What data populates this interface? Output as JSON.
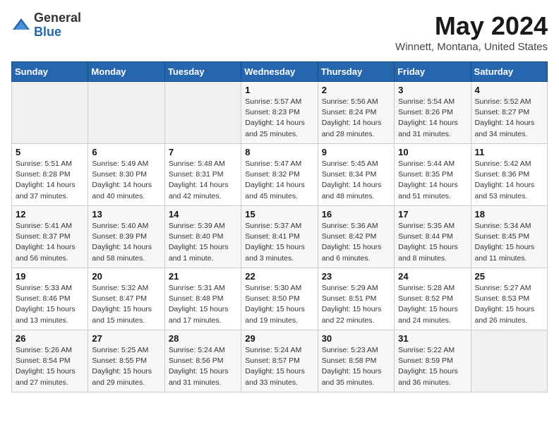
{
  "header": {
    "logo_general": "General",
    "logo_blue": "Blue",
    "main_title": "May 2024",
    "subtitle": "Winnett, Montana, United States"
  },
  "calendar": {
    "days_of_week": [
      "Sunday",
      "Monday",
      "Tuesday",
      "Wednesday",
      "Thursday",
      "Friday",
      "Saturday"
    ],
    "weeks": [
      [
        {
          "day": "",
          "info": ""
        },
        {
          "day": "",
          "info": ""
        },
        {
          "day": "",
          "info": ""
        },
        {
          "day": "1",
          "info": "Sunrise: 5:57 AM\nSunset: 8:23 PM\nDaylight: 14 hours\nand 25 minutes."
        },
        {
          "day": "2",
          "info": "Sunrise: 5:56 AM\nSunset: 8:24 PM\nDaylight: 14 hours\nand 28 minutes."
        },
        {
          "day": "3",
          "info": "Sunrise: 5:54 AM\nSunset: 8:26 PM\nDaylight: 14 hours\nand 31 minutes."
        },
        {
          "day": "4",
          "info": "Sunrise: 5:52 AM\nSunset: 8:27 PM\nDaylight: 14 hours\nand 34 minutes."
        }
      ],
      [
        {
          "day": "5",
          "info": "Sunrise: 5:51 AM\nSunset: 8:28 PM\nDaylight: 14 hours\nand 37 minutes."
        },
        {
          "day": "6",
          "info": "Sunrise: 5:49 AM\nSunset: 8:30 PM\nDaylight: 14 hours\nand 40 minutes."
        },
        {
          "day": "7",
          "info": "Sunrise: 5:48 AM\nSunset: 8:31 PM\nDaylight: 14 hours\nand 42 minutes."
        },
        {
          "day": "8",
          "info": "Sunrise: 5:47 AM\nSunset: 8:32 PM\nDaylight: 14 hours\nand 45 minutes."
        },
        {
          "day": "9",
          "info": "Sunrise: 5:45 AM\nSunset: 8:34 PM\nDaylight: 14 hours\nand 48 minutes."
        },
        {
          "day": "10",
          "info": "Sunrise: 5:44 AM\nSunset: 8:35 PM\nDaylight: 14 hours\nand 51 minutes."
        },
        {
          "day": "11",
          "info": "Sunrise: 5:42 AM\nSunset: 8:36 PM\nDaylight: 14 hours\nand 53 minutes."
        }
      ],
      [
        {
          "day": "12",
          "info": "Sunrise: 5:41 AM\nSunset: 8:37 PM\nDaylight: 14 hours\nand 56 minutes."
        },
        {
          "day": "13",
          "info": "Sunrise: 5:40 AM\nSunset: 8:39 PM\nDaylight: 14 hours\nand 58 minutes."
        },
        {
          "day": "14",
          "info": "Sunrise: 5:39 AM\nSunset: 8:40 PM\nDaylight: 15 hours\nand 1 minute."
        },
        {
          "day": "15",
          "info": "Sunrise: 5:37 AM\nSunset: 8:41 PM\nDaylight: 15 hours\nand 3 minutes."
        },
        {
          "day": "16",
          "info": "Sunrise: 5:36 AM\nSunset: 8:42 PM\nDaylight: 15 hours\nand 6 minutes."
        },
        {
          "day": "17",
          "info": "Sunrise: 5:35 AM\nSunset: 8:44 PM\nDaylight: 15 hours\nand 8 minutes."
        },
        {
          "day": "18",
          "info": "Sunrise: 5:34 AM\nSunset: 8:45 PM\nDaylight: 15 hours\nand 11 minutes."
        }
      ],
      [
        {
          "day": "19",
          "info": "Sunrise: 5:33 AM\nSunset: 8:46 PM\nDaylight: 15 hours\nand 13 minutes."
        },
        {
          "day": "20",
          "info": "Sunrise: 5:32 AM\nSunset: 8:47 PM\nDaylight: 15 hours\nand 15 minutes."
        },
        {
          "day": "21",
          "info": "Sunrise: 5:31 AM\nSunset: 8:48 PM\nDaylight: 15 hours\nand 17 minutes."
        },
        {
          "day": "22",
          "info": "Sunrise: 5:30 AM\nSunset: 8:50 PM\nDaylight: 15 hours\nand 19 minutes."
        },
        {
          "day": "23",
          "info": "Sunrise: 5:29 AM\nSunset: 8:51 PM\nDaylight: 15 hours\nand 22 minutes."
        },
        {
          "day": "24",
          "info": "Sunrise: 5:28 AM\nSunset: 8:52 PM\nDaylight: 15 hours\nand 24 minutes."
        },
        {
          "day": "25",
          "info": "Sunrise: 5:27 AM\nSunset: 8:53 PM\nDaylight: 15 hours\nand 26 minutes."
        }
      ],
      [
        {
          "day": "26",
          "info": "Sunrise: 5:26 AM\nSunset: 8:54 PM\nDaylight: 15 hours\nand 27 minutes."
        },
        {
          "day": "27",
          "info": "Sunrise: 5:25 AM\nSunset: 8:55 PM\nDaylight: 15 hours\nand 29 minutes."
        },
        {
          "day": "28",
          "info": "Sunrise: 5:24 AM\nSunset: 8:56 PM\nDaylight: 15 hours\nand 31 minutes."
        },
        {
          "day": "29",
          "info": "Sunrise: 5:24 AM\nSunset: 8:57 PM\nDaylight: 15 hours\nand 33 minutes."
        },
        {
          "day": "30",
          "info": "Sunrise: 5:23 AM\nSunset: 8:58 PM\nDaylight: 15 hours\nand 35 minutes."
        },
        {
          "day": "31",
          "info": "Sunrise: 5:22 AM\nSunset: 8:59 PM\nDaylight: 15 hours\nand 36 minutes."
        },
        {
          "day": "",
          "info": ""
        }
      ]
    ]
  }
}
